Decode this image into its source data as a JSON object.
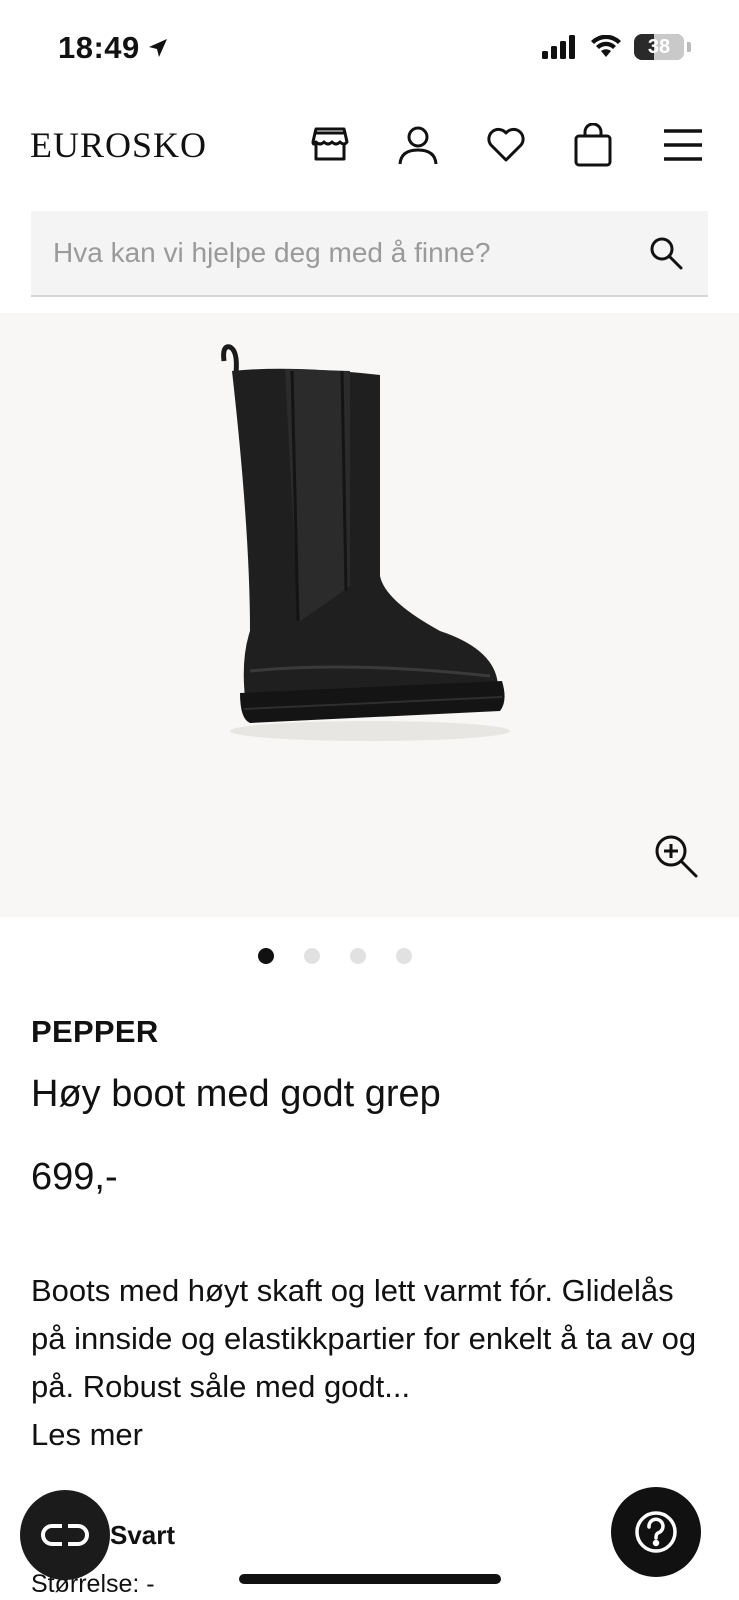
{
  "status_bar": {
    "time": "18:49",
    "battery": "38"
  },
  "header": {
    "logo": "EUROSKO",
    "icons": [
      "store-icon",
      "account-icon",
      "wishlist-heart-icon",
      "cart-bag-icon",
      "menu-icon"
    ]
  },
  "search": {
    "placeholder": "Hva kan vi hjelpe deg med å finne?"
  },
  "product": {
    "brand": "PEPPER",
    "name": "Høy boot med godt grep",
    "price": "699,-",
    "description": "Boots med høyt skaft og lett varmt fór. Glidelås på innside og elastikkpartier for enkelt å ta av og på. Robust såle med godt...",
    "read_more": "Les mer",
    "color_label": "Svart",
    "size_label": "Størrelse: -",
    "image_count": 4,
    "active_image": 1
  },
  "colors": {
    "accent": "#111111",
    "image_bg": "#f8f7f5",
    "search_bg": "#f4f4f4"
  }
}
